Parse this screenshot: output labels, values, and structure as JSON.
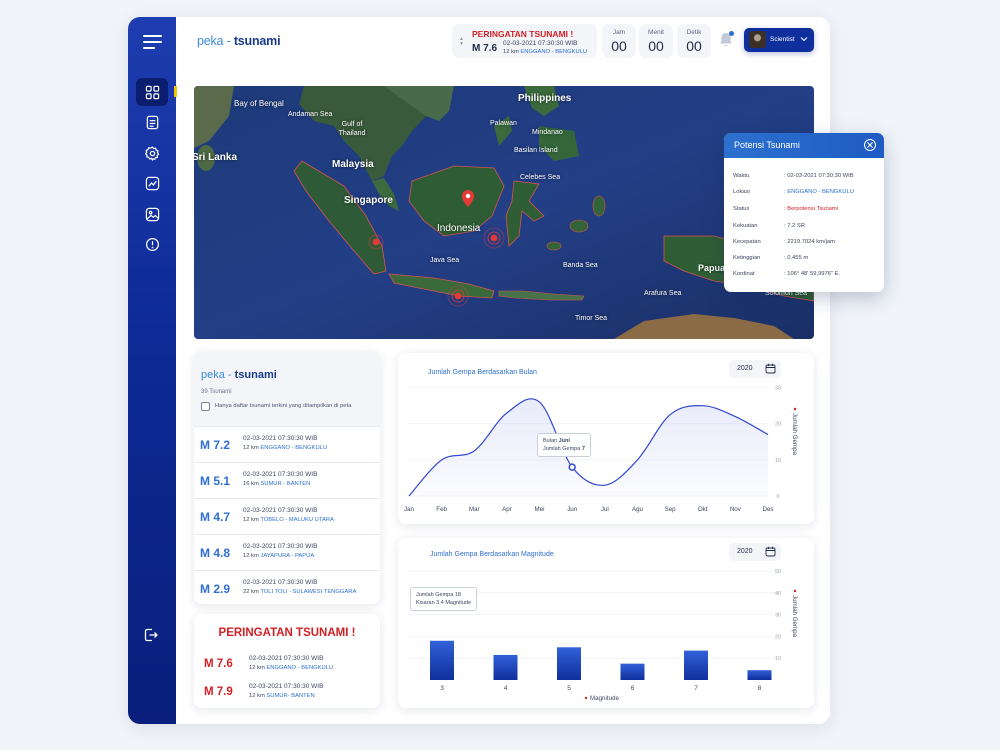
{
  "app": {
    "brand_part1": "peka",
    "brand_sep": " - ",
    "brand_part2": "tsunami"
  },
  "header": {
    "alert": {
      "title": "PERINGATAN TSUNAMI !",
      "magnitude": "M 7.6",
      "datetime": "02-03-2021  07:30:30 WIB",
      "distance": "12 km",
      "location": "ENGGANO - BENGKULU"
    },
    "time": [
      {
        "label": "Jam",
        "value": "00"
      },
      {
        "label": "Menit",
        "value": "00"
      },
      {
        "label": "Detik",
        "value": "00"
      }
    ],
    "user": {
      "name": "Scientist"
    }
  },
  "sidebar": {
    "items": [
      {
        "name": "dashboard-icon",
        "active": true
      },
      {
        "name": "document-icon",
        "active": false
      },
      {
        "name": "gear-icon",
        "active": false
      },
      {
        "name": "trend-chart-icon",
        "active": false
      },
      {
        "name": "image-icon",
        "active": false
      },
      {
        "name": "info-icon",
        "active": false
      }
    ],
    "logout": "logout-icon"
  },
  "map": {
    "labels": [
      "Bay of Bengal",
      "Andaman Sea",
      "Gulf of Thailand",
      "Philippines",
      "Palawan",
      "Mindanao",
      "Basilan Island",
      "Sri Lanka",
      "Malaysia",
      "Celebes Sea",
      "Singapore",
      "Indonesia",
      "Java Sea",
      "Banda Sea",
      "Arafura Sea",
      "Timor Sea",
      "Solomon Sea",
      "Papua New Guinea"
    ]
  },
  "potensi": {
    "title": "Potensi Tsunami",
    "rows": [
      {
        "key": "Waktu",
        "value": ": 02-03-2021  07:30:30 WIB",
        "style": ""
      },
      {
        "key": "Lokasi",
        "value": ": ENGGANO - BENGKULU",
        "style": "blue"
      },
      {
        "key": "Status",
        "value": ": Berpotensi Tsunami",
        "style": "red"
      },
      {
        "key": "Kekuatan",
        "value": ": 7.2  SR",
        "style": ""
      },
      {
        "key": "Kecepatan",
        "value": ": 2219.7024 km/jam",
        "style": ""
      },
      {
        "key": "Ketinggian",
        "value": ": 0.455 m",
        "style": ""
      },
      {
        "key": "Kordinat",
        "value": ": 106° 48' 59,9976\" E.",
        "style": ""
      }
    ]
  },
  "list": {
    "count": "39 Tsunami",
    "filter_label": "Hanya daftar tsunami terkini yang ditampilkan di peta",
    "items": [
      {
        "magnitude": "M 7.2",
        "datetime": "02-03-2021  07:30:30 WIB",
        "distance": "12 km",
        "location": "ENGGANO - BENGKULU"
      },
      {
        "magnitude": "M 5.1",
        "datetime": "02-03-2021  07:30:30 WIB",
        "distance": "16 km",
        "location": "SUMUR - BANTEN"
      },
      {
        "magnitude": "M 4.7",
        "datetime": "02-03-2021  07:30:30 WIB",
        "distance": "12 km",
        "location": "TOBELO - MALUKU UTARA"
      },
      {
        "magnitude": "M 4.8",
        "datetime": "02-03-2021  07:30:30 WIB",
        "distance": "12 km",
        "location": "JAYAPURA - PAPUA"
      },
      {
        "magnitude": "M 2.9",
        "datetime": "02-03-2021  07:30:30 WIB",
        "distance": "22 km",
        "location": "TOLI TOLI - SULAWESI TENGGARA"
      }
    ]
  },
  "warning": {
    "title": "PERINGATAN TSUNAMI !",
    "items": [
      {
        "magnitude": "M 7.6",
        "datetime": "02-03-2021  07:30:30 WIB",
        "distance": "12 km",
        "location": "ENGGANO - BENGKULU"
      },
      {
        "magnitude": "M 7.9",
        "datetime": "02-03-2021  07:30:30 WIB",
        "distance": "12 km",
        "location": "SUMUR- BANTEN"
      }
    ]
  },
  "chart_data": [
    {
      "type": "line",
      "title": "Jumlah Gempa Berdasarkan Bulan",
      "year": "2020",
      "ylabel": "Jumlah Gempa",
      "categories": [
        "Jan",
        "Feb",
        "Mar",
        "Apr",
        "Mei",
        "Jun",
        "Jul",
        "Agu",
        "Sep",
        "Okt",
        "Nov",
        "Des"
      ],
      "values": [
        0,
        10,
        12.5,
        23,
        26,
        8,
        3,
        10,
        22.5,
        25,
        22,
        17
      ],
      "yticks": [
        0,
        10,
        20,
        30
      ],
      "ylim": [
        0,
        31
      ],
      "grid": true,
      "tooltip": {
        "line1_label": "Bulan",
        "line1_value": "Juni",
        "line2_label": "Jumlah Gempa",
        "line2_value": "7"
      }
    },
    {
      "type": "bar",
      "title": "Jumlah Gempa Berdasarkan Magnitude",
      "year": "2020",
      "xlabel": "Magnitude",
      "ylabel": "Jumlah Gempa",
      "categories": [
        "3",
        "4",
        "5",
        "6",
        "7",
        "8"
      ],
      "values": [
        18,
        11.5,
        15,
        7.5,
        13.5,
        4.5
      ],
      "yticks": [
        10,
        20,
        30,
        40,
        50
      ],
      "ylim": [
        0,
        50
      ],
      "grid": true,
      "tooltip": {
        "line1": "Jumlah Gempa 18",
        "line2": "Kisaran 3.4 Magnitude"
      }
    }
  ],
  "colors": {
    "primary": "#0f2f9c",
    "accent": "#2f6fd0",
    "danger": "#d21f25",
    "marker": "#f5c400"
  }
}
